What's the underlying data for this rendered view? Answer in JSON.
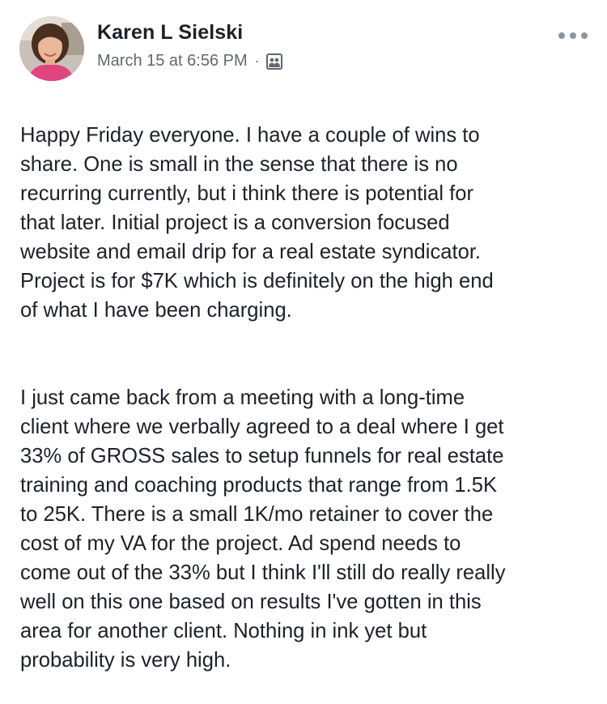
{
  "post": {
    "author": "Karen L Sielski",
    "timestamp": "March 15 at 6:56 PM",
    "separator": "·",
    "audience_icon": "group-icon",
    "more_icon": "more-options-icon",
    "paragraphs": [
      "Happy Friday everyone.  I have a couple of wins to\nshare.  One is small in the sense that there is no\nrecurring currently, but i think there is potential for\nthat later.  Initial project is a conversion focused\nwebsite and email drip for a real estate syndicator.\nProject is for $7K which is definitely on the high end\nof what I have been charging.",
      "I just came back from a meeting with a long-time\nclient where we verbally agreed to a deal where I get\n33% of GROSS sales to setup funnels for real estate\ntraining and coaching products that range from 1.5K\nto 25K. There is  a small 1K/mo retainer to cover the\ncost of my VA for the project.  Ad spend needs to\ncome out of the 33% but I think I'll still do really really\nwell on this one based on results I've gotten in this\narea for another client. Nothing in ink yet but\nprobability is very high."
    ]
  },
  "colors": {
    "text": "#1d2129",
    "meta": "#616770",
    "icon": "#8d949e"
  }
}
